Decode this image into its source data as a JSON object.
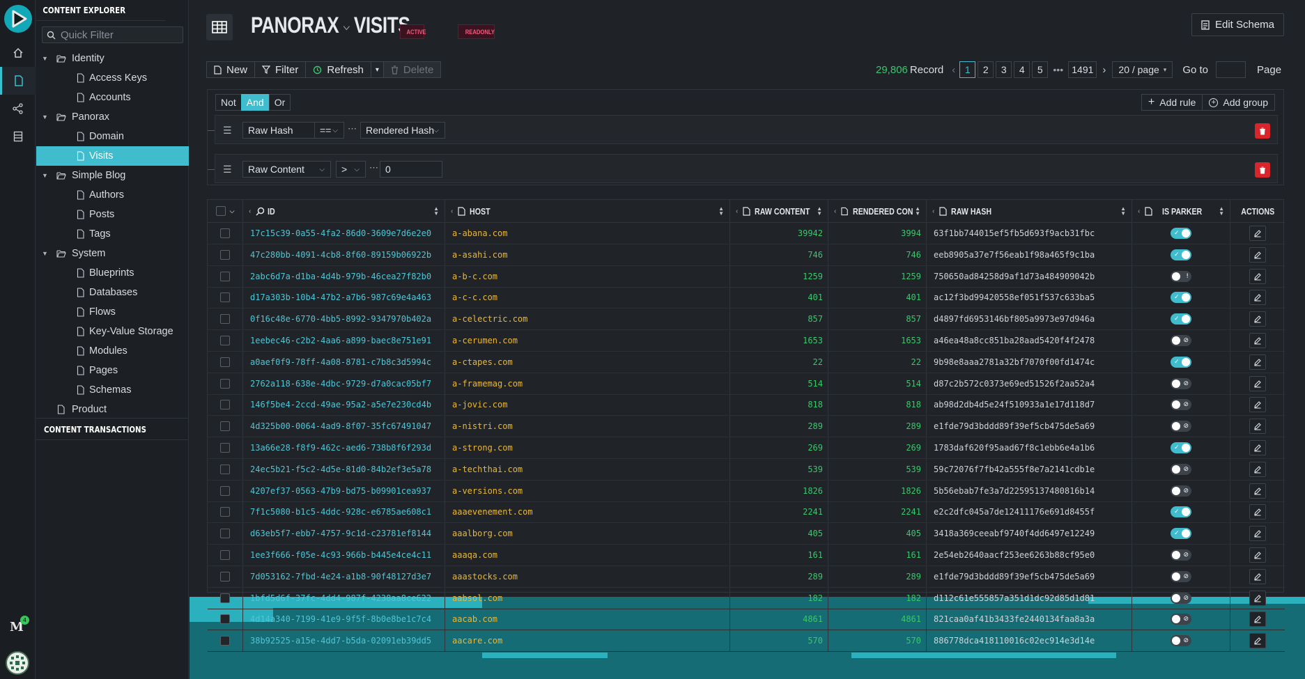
{
  "sidebar": {
    "header": "CONTENT EXPLORER",
    "quick_filter_placeholder": "Quick Filter",
    "tree": [
      {
        "label": "Identity",
        "type": "folder"
      },
      {
        "label": "Access Keys",
        "type": "file"
      },
      {
        "label": "Accounts",
        "type": "file"
      },
      {
        "label": "Panorax",
        "type": "folder"
      },
      {
        "label": "Domain",
        "type": "file"
      },
      {
        "label": "Visits",
        "type": "file",
        "selected": true
      },
      {
        "label": "Simple Blog",
        "type": "folder"
      },
      {
        "label": "Authors",
        "type": "file"
      },
      {
        "label": "Posts",
        "type": "file"
      },
      {
        "label": "Tags",
        "type": "file"
      },
      {
        "label": "System",
        "type": "folder"
      },
      {
        "label": "Blueprints",
        "type": "file"
      },
      {
        "label": "Databases",
        "type": "file"
      },
      {
        "label": "Flows",
        "type": "file"
      },
      {
        "label": "Key-Value Storage",
        "type": "file"
      },
      {
        "label": "Modules",
        "type": "file"
      },
      {
        "label": "Pages",
        "type": "file"
      },
      {
        "label": "Schemas",
        "type": "file"
      },
      {
        "label": "Product",
        "type": "file"
      }
    ],
    "footer": "CONTENT TRANSACTIONS"
  },
  "rail": {
    "badge": "4"
  },
  "header": {
    "database": "PANORAX",
    "table": "VISITS",
    "badge_active": "ACTIVE",
    "badge_readonly": "READONLY",
    "edit_schema": "Edit Schema"
  },
  "toolbar": {
    "new": "New",
    "filter": "Filter",
    "refresh": "Refresh",
    "delete": "Delete"
  },
  "pager": {
    "count": "29,806",
    "record_label": "Record",
    "pages": [
      "1",
      "2",
      "3",
      "4",
      "5"
    ],
    "ellipsis": "•••",
    "last": "1491",
    "page_size": "20 / page",
    "goto_label": "Go to",
    "page_label": "Page"
  },
  "filter": {
    "not": "Not",
    "and": "And",
    "or": "Or",
    "add_rule": "Add rule",
    "add_group": "Add group",
    "rules": [
      {
        "field": "Raw Hash",
        "op": "==",
        "value": "Rendered Hash"
      },
      {
        "field": "Raw Content",
        "op": ">",
        "value": "0"
      }
    ]
  },
  "table": {
    "columns": [
      "ID",
      "HOST",
      "RAW CONTENT",
      "RENDERED CON",
      "RAW HASH",
      "IS PARKER",
      "ACTIONS"
    ],
    "rows": [
      {
        "id": "17c15c39-0a55-4fa2-86d0-3609e7d6e2e0",
        "host": "a-abana.com",
        "raw": "39942",
        "rendered": "3994",
        "hash": "63f1bb744015ef5fb5d693f9acb31fbc",
        "parker": true
      },
      {
        "id": "47c280bb-4091-4cb8-8f60-89159b06922b",
        "host": "a-asahi.com",
        "raw": "746",
        "rendered": "746",
        "hash": "eeb8905a37e7f56eab1f98a465f9c1ba",
        "parker": true
      },
      {
        "id": "2abc6d7a-d1ba-4d4b-979b-46cea27f82b0",
        "host": "a-b-c.com",
        "raw": "1259",
        "rendered": "1259",
        "hash": "750650ad84258d9af1d73a484909042b",
        "parker": "warn"
      },
      {
        "id": "d17a303b-10b4-47b2-a7b6-987c69e4a463",
        "host": "a-c-c.com",
        "raw": "401",
        "rendered": "401",
        "hash": "ac12f3bd99420558ef051f537c633ba5",
        "parker": true
      },
      {
        "id": "0f16c48e-6770-4bb5-8992-9347970b402a",
        "host": "a-celectric.com",
        "raw": "857",
        "rendered": "857",
        "hash": "d4897fd6953146bf805a9973e97d946a",
        "parker": true
      },
      {
        "id": "1eebec46-c2b2-4aa6-a899-baec8e751e91",
        "host": "a-cerumen.com",
        "raw": "1653",
        "rendered": "1653",
        "hash": "a46ea48a8cc851ba28aad5420f4f2478",
        "parker": false
      },
      {
        "id": "a0aef0f9-78ff-4a08-8781-c7b8c3d5994c",
        "host": "a-ctapes.com",
        "raw": "22",
        "rendered": "22",
        "hash": "9b98e8aaa2781a32bf7070f00fd1474c",
        "parker": true
      },
      {
        "id": "2762a118-638e-4dbc-9729-d7a0cac05bf7",
        "host": "a-framemag.com",
        "raw": "514",
        "rendered": "514",
        "hash": "d87c2b572c0373e69ed51526f2aa52a4",
        "parker": false
      },
      {
        "id": "146f5be4-2ccd-49ae-95a2-a5e7e230cd4b",
        "host": "a-jovic.com",
        "raw": "818",
        "rendered": "818",
        "hash": "ab98d2db4d5e24f510933a1e17d118d7",
        "parker": false
      },
      {
        "id": "4d325b00-0064-4ad9-8f07-35fc67491047",
        "host": "a-nistri.com",
        "raw": "289",
        "rendered": "289",
        "hash": "e1fde79d3bddd89f39ef5cb475de5a69",
        "parker": false
      },
      {
        "id": "13a66e28-f8f9-462c-aed6-738b8f6f293d",
        "host": "a-strong.com",
        "raw": "269",
        "rendered": "269",
        "hash": "1783daf620f95aad67f8c1ebb6e4a1b6",
        "parker": true
      },
      {
        "id": "24ec5b21-f5c2-4d5e-81d0-84b2ef3e5a78",
        "host": "a-techthai.com",
        "raw": "539",
        "rendered": "539",
        "hash": "59c72076f7fb42a555f8e7a2141cdb1e",
        "parker": false
      },
      {
        "id": "4207ef37-0563-47b9-bd75-b09901cea937",
        "host": "a-versions.com",
        "raw": "1826",
        "rendered": "1826",
        "hash": "5b56ebab7fe3a7d22595137480816b14",
        "parker": false
      },
      {
        "id": "7f1c5080-b1c5-4ddc-928c-e6785ae608c1",
        "host": "aaaevenement.com",
        "raw": "2241",
        "rendered": "2241",
        "hash": "e2c2dfc045a7de12411176e691d8455f",
        "parker": true
      },
      {
        "id": "d63eb5f7-ebb7-4757-9c1d-c23781ef8144",
        "host": "aaalborg.com",
        "raw": "405",
        "rendered": "405",
        "hash": "3418a369ceeabf9740f4dd6497e12249",
        "parker": true
      },
      {
        "id": "1ee3f666-f05e-4c93-966b-b445e4ce4c11",
        "host": "aaaqa.com",
        "raw": "161",
        "rendered": "161",
        "hash": "2e54eb2640aacf253ee6263b88cf95e0",
        "parker": false
      },
      {
        "id": "7d053162-7fbd-4e24-a1b8-90f48127d3e7",
        "host": "aaastocks.com",
        "raw": "289",
        "rendered": "289",
        "hash": "e1fde79d3bddd89f39ef5cb475de5a69",
        "parker": false
      },
      {
        "id": "1bfd5d6f-37fc-4dd4-987f-4238aa8ce622",
        "host": "aabsol.com",
        "raw": "182",
        "rendered": "182",
        "hash": "d112c61e555857a351d1dc92d85d1d81",
        "parker": false
      },
      {
        "id": "4d14a340-7199-41e9-9f5f-8b0e8be1c7c4",
        "host": "aacab.com",
        "raw": "4861",
        "rendered": "4861",
        "hash": "821caa0af41b3433fe2440134faa8a3a",
        "parker": false
      },
      {
        "id": "38b92525-a15e-4dd7-b5da-02091eb39dd5",
        "host": "aacare.com",
        "raw": "570",
        "rendered": "570",
        "hash": "886778dca418110016c02ec914e3d14e",
        "parker": false
      }
    ]
  },
  "colors": {
    "accent": "#3fbccd",
    "number": "#37c86a",
    "host": "#e8b739",
    "id": "#4fc5d6",
    "danger": "#d8252b"
  }
}
